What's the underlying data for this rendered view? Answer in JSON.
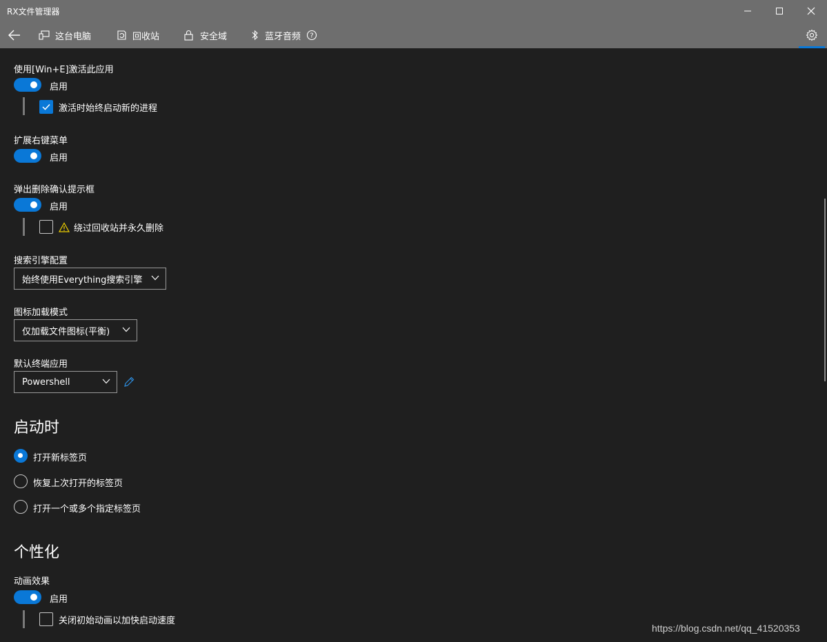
{
  "window": {
    "title": "RX文件管理器"
  },
  "nav": {
    "items": [
      {
        "label": "这台电脑",
        "icon": "computer-icon"
      },
      {
        "label": "回收站",
        "icon": "recycle-bin-icon"
      },
      {
        "label": "安全域",
        "icon": "lock-icon"
      },
      {
        "label": "蓝牙音频",
        "icon": "bluetooth-icon"
      }
    ],
    "help_icon": "help-icon",
    "settings_icon": "gear-icon"
  },
  "settings": {
    "win_e": {
      "title": "使用[Win+E]激活此应用",
      "toggle_label": "启用",
      "sub_option": "激活时始终启动新的进程",
      "sub_checked": true
    },
    "context_menu": {
      "title": "扩展右键菜单",
      "toggle_label": "启用"
    },
    "delete_confirm": {
      "title": "弹出删除确认提示框",
      "toggle_label": "启用",
      "sub_option": "绕过回收站并永久删除",
      "sub_checked": false
    },
    "search_engine": {
      "title": "搜索引擎配置",
      "selected": "始终使用Everything搜索引擎"
    },
    "icon_load": {
      "title": "图标加载模式",
      "selected": "仅加载文件图标(平衡)"
    },
    "terminal": {
      "title": "默认终端应用",
      "selected": "Powershell"
    }
  },
  "startup": {
    "title": "启动时",
    "options": [
      {
        "label": "打开新标签页",
        "selected": true
      },
      {
        "label": "恢复上次打开的标签页",
        "selected": false
      },
      {
        "label": "打开一个或多个指定标签页",
        "selected": false
      }
    ]
  },
  "personalization": {
    "title": "个性化",
    "animation": {
      "title": "动画效果",
      "toggle_label": "启用",
      "sub_option": "关闭初始动画以加快启动速度",
      "sub_checked": false
    }
  },
  "watermark": "https://blog.csdn.net/qq_41520353",
  "colors": {
    "accent": "#0a78d7",
    "background": "#1f1f1f",
    "titlebar": "#6e6e6e"
  }
}
